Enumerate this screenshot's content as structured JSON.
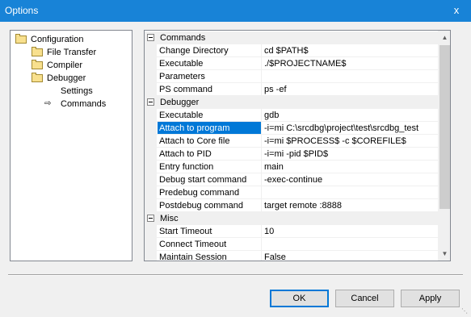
{
  "window": {
    "title": "Options",
    "close_glyph": "x"
  },
  "tree": {
    "items": [
      {
        "label": "Configuration",
        "icon": "folder-open-icon",
        "level": 0
      },
      {
        "label": "File Transfer",
        "icon": "folder-icon",
        "level": 1
      },
      {
        "label": "Compiler",
        "icon": "folder-icon",
        "level": 1
      },
      {
        "label": "Debugger",
        "icon": "folder-open-icon",
        "level": 1
      },
      {
        "label": "Settings",
        "icon": "",
        "level": 2
      },
      {
        "label": "Commands",
        "icon": "arrow-right-icon",
        "level": 2,
        "selected": true
      }
    ]
  },
  "grid": {
    "categories": [
      {
        "label": "Commands",
        "rows": [
          {
            "name": "Change Directory",
            "value": "cd $PATH$"
          },
          {
            "name": "Executable",
            "value": "./$PROJECTNAME$"
          },
          {
            "name": "Parameters",
            "value": ""
          },
          {
            "name": "PS command",
            "value": "ps -ef"
          }
        ]
      },
      {
        "label": "Debugger",
        "rows": [
          {
            "name": "Executable",
            "value": "gdb"
          },
          {
            "name": "Attach to program",
            "value": "-i=mi C:\\srcdbg\\project\\test\\srcdbg_test",
            "selected": true
          },
          {
            "name": "Attach to Core file",
            "value": "-i=mi $PROCESS$ -c $COREFILE$"
          },
          {
            "name": "Attach to PID",
            "value": "-i=mi -pid $PID$"
          },
          {
            "name": "Entry function",
            "value": "main"
          },
          {
            "name": "Debug start command",
            "value": "-exec-continue"
          },
          {
            "name": "Predebug command",
            "value": ""
          },
          {
            "name": "Postdebug command",
            "value": "target remote :8888"
          }
        ]
      },
      {
        "label": "Misc",
        "rows": [
          {
            "name": "Start Timeout",
            "value": "10"
          },
          {
            "name": "Connect Timeout",
            "value": ""
          },
          {
            "name": "Maintain Session",
            "value": "False"
          }
        ]
      }
    ]
  },
  "buttons": {
    "ok": "OK",
    "cancel": "Cancel",
    "apply": "Apply"
  },
  "colors": {
    "titlebar": "#1883d7",
    "selection": "#0078d7"
  }
}
